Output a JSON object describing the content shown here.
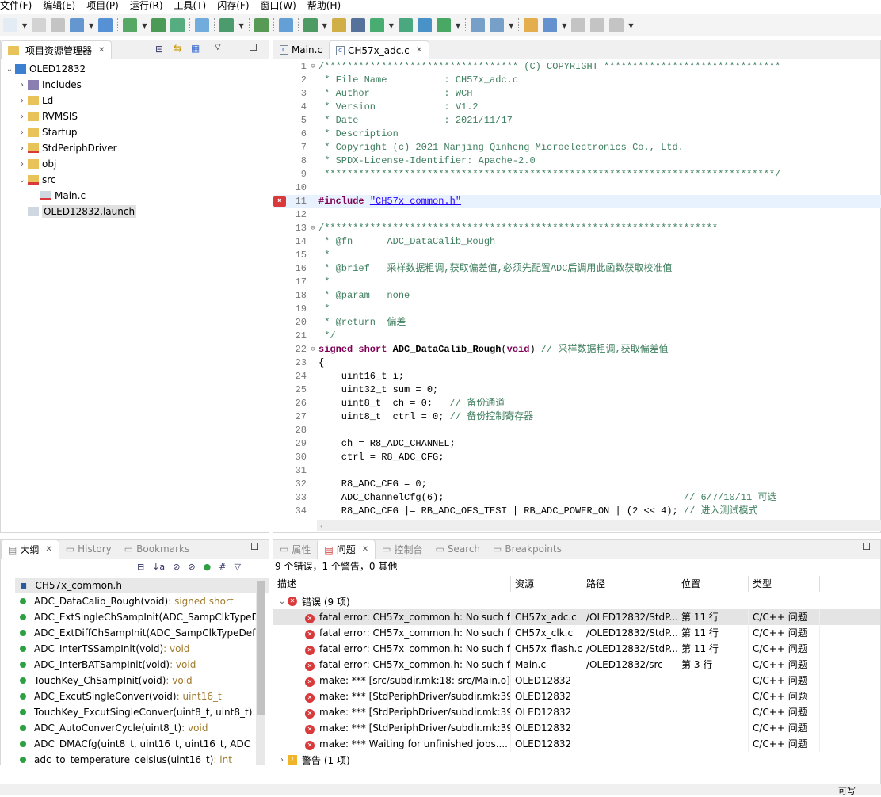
{
  "menu": [
    "文件(F)",
    "编辑(E)",
    "项目(P)",
    "运行(R)",
    "工具(T)",
    "闪存(F)",
    "窗口(W)",
    "帮助(H)"
  ],
  "colors": {
    "accent": "#d9393a",
    "comment": "#3f7f5f",
    "keyword": "#7f0055",
    "string": "#2a00ff"
  },
  "explorer": {
    "title": "项目资源管理器",
    "items": [
      {
        "label": "OLED12832",
        "chev": "⌄",
        "depth": 0,
        "icon": "project-icon"
      },
      {
        "label": "Includes",
        "chev": "›",
        "depth": 1,
        "icon": "includes-icon"
      },
      {
        "label": "Ld",
        "chev": "›",
        "depth": 1,
        "icon": "folder-icon"
      },
      {
        "label": "RVMSIS",
        "chev": "›",
        "depth": 1,
        "icon": "folder-icon"
      },
      {
        "label": "Startup",
        "chev": "›",
        "depth": 1,
        "icon": "folder-icon"
      },
      {
        "label": "StdPeriphDriver",
        "chev": "›",
        "depth": 1,
        "icon": "folder-error-icon"
      },
      {
        "label": "obj",
        "chev": "›",
        "depth": 1,
        "icon": "folder-icon"
      },
      {
        "label": "src",
        "chev": "⌄",
        "depth": 1,
        "icon": "folder-error-icon"
      },
      {
        "label": "Main.c",
        "chev": "",
        "depth": 2,
        "icon": "c-file-error-icon"
      },
      {
        "label": "OLED12832.launch",
        "chev": "",
        "depth": 1,
        "icon": "launch-file-icon",
        "selected": true
      }
    ]
  },
  "editor": {
    "tabs": [
      {
        "label": "Main.c",
        "active": false
      },
      {
        "label": "CH57x_adc.c",
        "active": true
      }
    ],
    "lines": [
      [
        [
          "c",
          "/********************************** (C) COPYRIGHT *******************************"
        ]
      ],
      [
        [
          "c",
          " * File Name          : CH57x_adc.c"
        ]
      ],
      [
        [
          "c",
          " * Author             : WCH"
        ]
      ],
      [
        [
          "c",
          " * Version            : V1.2"
        ]
      ],
      [
        [
          "c",
          " * Date               : 2021/11/17"
        ]
      ],
      [
        [
          "c",
          " * Description"
        ]
      ],
      [
        [
          "c",
          " * Copyright (c) 2021 Nanjing Qinheng Microelectronics Co., Ltd."
        ]
      ],
      [
        [
          "c",
          " * SPDX-License-Identifier: Apache-2.0"
        ]
      ],
      [
        [
          "c",
          " *******************************************************************************/"
        ]
      ],
      [
        [
          "n",
          ""
        ]
      ],
      [
        [
          "k",
          "#include "
        ],
        [
          "s",
          "\"CH57x_common.h\""
        ]
      ],
      [
        [
          "n",
          ""
        ]
      ],
      [
        [
          "c",
          "/*********************************************************************"
        ]
      ],
      [
        [
          "c",
          " * @fn      ADC_DataCalib_Rough"
        ]
      ],
      [
        [
          "c",
          " *"
        ]
      ],
      [
        [
          "c",
          " * @brief   采样数据粗调,获取偏差值,必须先配置ADC后调用此函数获取校准值"
        ]
      ],
      [
        [
          "c",
          " *"
        ]
      ],
      [
        [
          "c",
          " * @param   none"
        ]
      ],
      [
        [
          "c",
          " *"
        ]
      ],
      [
        [
          "c",
          " * @return  偏差"
        ]
      ],
      [
        [
          "c",
          " */"
        ]
      ],
      [
        [
          "k",
          "signed short "
        ],
        [
          "f",
          "ADC_DataCalib_Rough"
        ],
        [
          "n",
          "("
        ],
        [
          "k",
          "void"
        ],
        [
          "n",
          ") "
        ],
        [
          "c",
          "// 采样数据粗调,获取偏差值"
        ]
      ],
      [
        [
          "n",
          "{"
        ]
      ],
      [
        [
          "n",
          "    uint16_t i;"
        ]
      ],
      [
        [
          "n",
          "    uint32_t sum = 0;"
        ]
      ],
      [
        [
          "n",
          "    uint8_t  ch = 0;   "
        ],
        [
          "c",
          "// 备份通道"
        ]
      ],
      [
        [
          "n",
          "    uint8_t  ctrl = 0; "
        ],
        [
          "c",
          "// 备份控制寄存器"
        ]
      ],
      [
        [
          "n",
          ""
        ]
      ],
      [
        [
          "n",
          "    ch = R8_ADC_CHANNEL;"
        ]
      ],
      [
        [
          "n",
          "    ctrl = R8_ADC_CFG;"
        ]
      ],
      [
        [
          "n",
          ""
        ]
      ],
      [
        [
          "n",
          "    R8_ADC_CFG = 0;"
        ]
      ],
      [
        [
          "n",
          "    ADC_ChannelCfg(6);                                          "
        ],
        [
          "c",
          "// 6/7/10/11 可选"
        ]
      ],
      [
        [
          "n",
          "    R8_ADC_CFG |= RB_ADC_OFS_TEST | RB_ADC_POWER_ON | (2 << 4); "
        ],
        [
          "c",
          "// 进入测试模式"
        ]
      ]
    ],
    "fold_lines": [
      1,
      13,
      22
    ],
    "error_line": 11,
    "current_line": 11
  },
  "outline": {
    "tabs": [
      "大纲",
      "History",
      "Bookmarks"
    ],
    "items": [
      {
        "name": "CH57x_common.h",
        "type": "",
        "kind": "include"
      },
      {
        "name": "ADC_DataCalib_Rough(void)",
        "type": " : signed short"
      },
      {
        "name": "ADC_ExtSingleChSampInit(ADC_SampClkTypeD",
        "type": ""
      },
      {
        "name": "ADC_ExtDiffChSampInit(ADC_SampClkTypeDef,",
        "type": ""
      },
      {
        "name": "ADC_InterTSSampInit(void)",
        "type": " : void"
      },
      {
        "name": "ADC_InterBATSampInit(void)",
        "type": " : void"
      },
      {
        "name": "TouchKey_ChSampInit(void)",
        "type": " : void"
      },
      {
        "name": "ADC_ExcutSingleConver(void)",
        "type": " : uint16_t"
      },
      {
        "name": "TouchKey_ExcutSingleConver(uint8_t, uint8_t)",
        "type": " : u"
      },
      {
        "name": "ADC_AutoConverCycle(uint8_t)",
        "type": " : void"
      },
      {
        "name": "ADC_DMACfg(uint8_t, uint16_t, uint16_t, ADC_DI",
        "type": ""
      },
      {
        "name": "adc_to_temperature_celsius(uint16_t)",
        "type": " : int"
      }
    ]
  },
  "problems": {
    "tabs": [
      "属性",
      "问题",
      "控制台",
      "Search",
      "Breakpoints"
    ],
    "summary": "9 个错误，1 个警告，0 其他",
    "columns": [
      "描述",
      "资源",
      "路径",
      "位置",
      "类型"
    ],
    "error_group": "错误 (9 项)",
    "warning_group": "警告 (1 项)",
    "rows": [
      [
        "fatal error: CH57x_common.h: No such file",
        "CH57x_adc.c",
        "/OLED12832/StdP...",
        "第 11 行",
        "C/C++ 问题"
      ],
      [
        "fatal error: CH57x_common.h: No such file",
        "CH57x_clk.c",
        "/OLED12832/StdP...",
        "第 11 行",
        "C/C++ 问题"
      ],
      [
        "fatal error: CH57x_common.h: No such file",
        "CH57x_flash.c",
        "/OLED12832/StdP...",
        "第 11 行",
        "C/C++ 问题"
      ],
      [
        "fatal error: CH57x_common.h: No such file",
        "Main.c",
        "/OLED12832/src",
        "第 3 行",
        "C/C++ 问题"
      ],
      [
        "make: *** [src/subdir.mk:18: src/Main.o] E",
        "OLED12832",
        "",
        "",
        "C/C++ 问题"
      ],
      [
        "make: *** [StdPeriphDriver/subdir.mk:39: S",
        "OLED12832",
        "",
        "",
        "C/C++ 问题"
      ],
      [
        "make: *** [StdPeriphDriver/subdir.mk:39: S",
        "OLED12832",
        "",
        "",
        "C/C++ 问题"
      ],
      [
        "make: *** [StdPeriphDriver/subdir.mk:39: S",
        "OLED12832",
        "",
        "",
        "C/C++ 问题"
      ],
      [
        "make: *** Waiting for unfinished jobs....",
        "OLED12832",
        "",
        "",
        "C/C++ 问题"
      ]
    ]
  },
  "status": {
    "mode": "可写"
  }
}
